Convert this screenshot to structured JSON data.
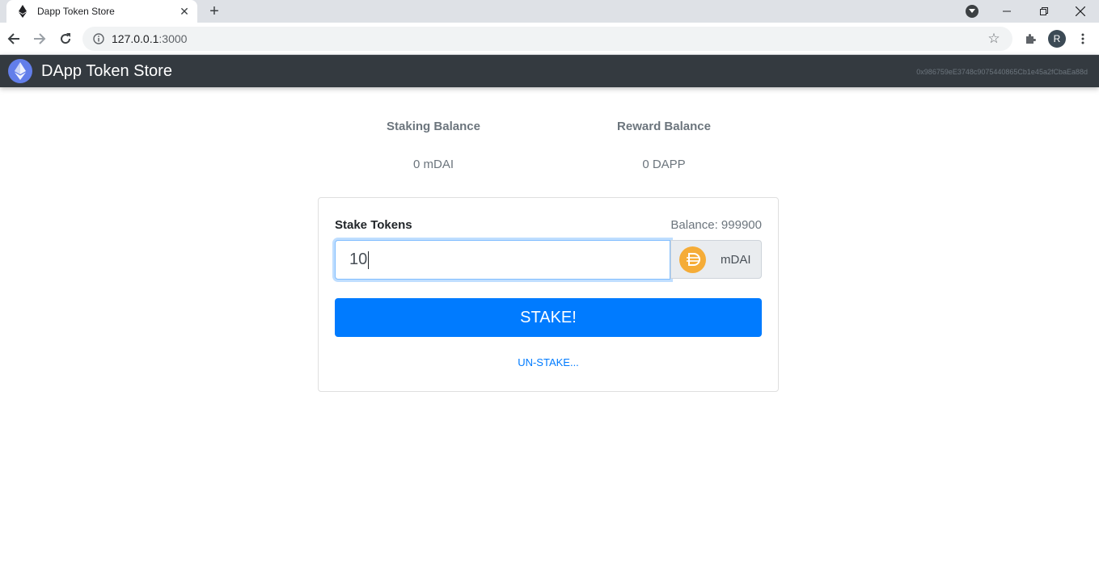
{
  "browser": {
    "tab_title": "Dapp Token Store",
    "url_host": "127.0.0.1",
    "url_port": ":3000",
    "profile_initial": "R"
  },
  "app": {
    "brand": "DApp Token Store",
    "account": "0x986759eE3748c9075440865Cb1e45a2fCbaEa88d"
  },
  "balances": {
    "staking_label": "Staking Balance",
    "staking_value": "0 mDAI",
    "reward_label": "Reward Balance",
    "reward_value": "0 DAPP"
  },
  "stake_form": {
    "title": "Stake Tokens",
    "balance": "Balance: 999900",
    "amount": "10",
    "unit": "mDAI",
    "stake_button": "STAKE!",
    "unstake_link": "UN-STAKE..."
  },
  "colors": {
    "primary": "#007bff",
    "navbar": "#343a40",
    "dai": "#f5ac37",
    "eth": "#627eea"
  }
}
